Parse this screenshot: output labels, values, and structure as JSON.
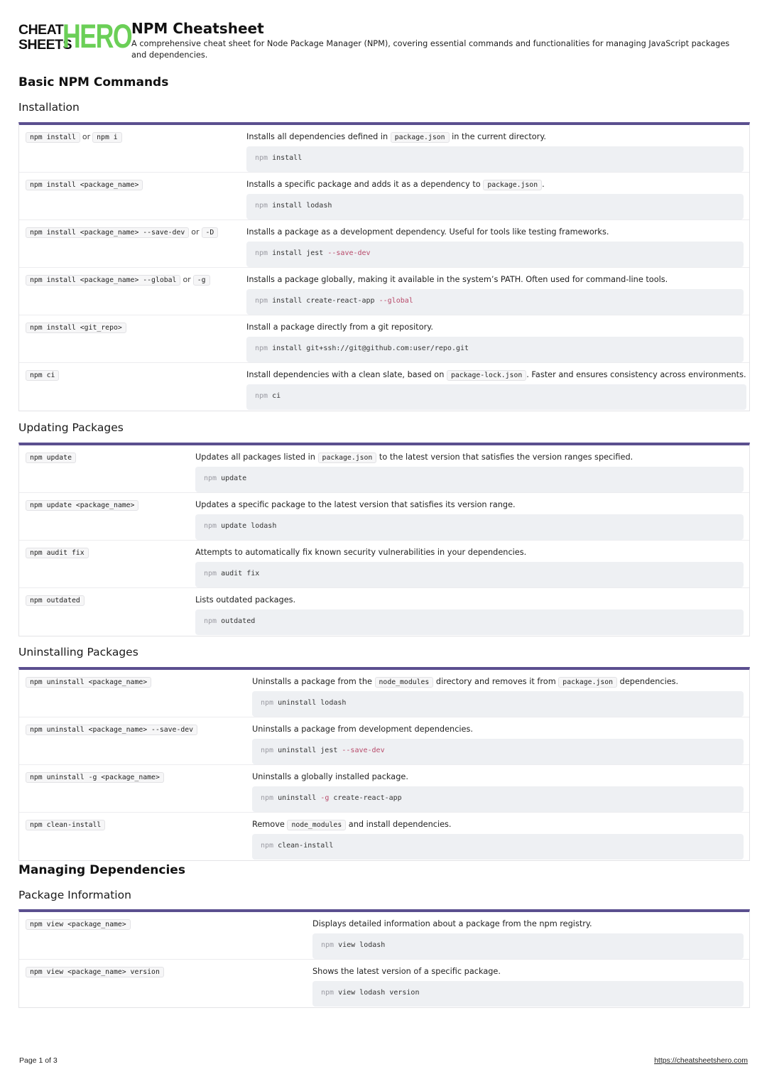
{
  "logo": {
    "line1": "CHEAT",
    "line2": "SHEETS",
    "hero": "HERO"
  },
  "header": {
    "title": "NPM Cheatsheet",
    "subtitle": "A comprehensive cheat sheet for Node Package Manager (NPM), covering essential commands and functionalities for managing JavaScript packages and dependencies."
  },
  "sections": [
    {
      "title": "Basic NPM Commands",
      "subsections": [
        {
          "title": "Installation",
          "rows": [
            {
              "cmd": [
                {
                  "k": "npm install"
                },
                {
                  "t": "or"
                },
                {
                  "k": "npm i"
                }
              ],
              "desc": [
                {
                  "t": "Installs all dependencies defined in "
                },
                {
                  "k": "package.json"
                },
                {
                  "t": " in the current directory."
                }
              ],
              "code": [
                {
                  "n": "npm"
                },
                {
                  "t": " install"
                }
              ]
            },
            {
              "cmd": [
                {
                  "k": "npm install <package_name>"
                }
              ],
              "desc": [
                {
                  "t": "Installs a specific package and adds it as a dependency to "
                },
                {
                  "k": "package.json"
                },
                {
                  "t": "."
                }
              ],
              "code": [
                {
                  "n": "npm"
                },
                {
                  "t": " install lodash"
                }
              ]
            },
            {
              "cmd": [
                {
                  "k": "npm install <package_name> --save-dev"
                },
                {
                  "t": "or"
                },
                {
                  "k": "-D"
                }
              ],
              "desc": [
                {
                  "t": "Installs a package as a development dependency. Useful for tools like testing frameworks."
                }
              ],
              "code": [
                {
                  "n": "npm"
                },
                {
                  "t": " install jest "
                },
                {
                  "f": "--save-dev"
                }
              ]
            },
            {
              "cmd": [
                {
                  "k": "npm install <package_name> --global"
                },
                {
                  "t": "or"
                },
                {
                  "k": "-g"
                }
              ],
              "desc": [
                {
                  "t": "Installs a package globally, making it available in the system’s PATH. Often used for command-line tools."
                }
              ],
              "code": [
                {
                  "n": "npm"
                },
                {
                  "t": " install create-react-app "
                },
                {
                  "f": "--global"
                }
              ]
            },
            {
              "cmd": [
                {
                  "k": "npm install <git_repo>"
                }
              ],
              "desc": [
                {
                  "t": "Install a package directly from a git repository."
                }
              ],
              "code": [
                {
                  "n": "npm"
                },
                {
                  "t": " install git+ssh://git@github.com:user/repo.git"
                }
              ]
            },
            {
              "cmd": [
                {
                  "k": "npm ci"
                }
              ],
              "desc": [
                {
                  "t": "Install dependencies with a clean slate, based on "
                },
                {
                  "k": "package-lock.json"
                },
                {
                  "t": ". Faster and ensures consistency across environments."
                }
              ],
              "code": [
                {
                  "n": "npm"
                },
                {
                  "t": " ci"
                }
              ]
            }
          ]
        },
        {
          "title": "Updating Packages",
          "rows": [
            {
              "cmd": [
                {
                  "k": "npm update"
                }
              ],
              "desc": [
                {
                  "t": "Updates all packages listed in "
                },
                {
                  "k": "package.json"
                },
                {
                  "t": " to the latest version that satisfies the version ranges specified."
                }
              ],
              "code": [
                {
                  "n": "npm"
                },
                {
                  "t": " update"
                }
              ]
            },
            {
              "cmd": [
                {
                  "k": "npm update <package_name>"
                }
              ],
              "desc": [
                {
                  "t": "Updates a specific package to the latest version that satisfies its version range."
                }
              ],
              "code": [
                {
                  "n": "npm"
                },
                {
                  "t": " update lodash"
                }
              ]
            },
            {
              "cmd": [
                {
                  "k": "npm audit fix"
                }
              ],
              "desc": [
                {
                  "t": "Attempts to automatically fix known security vulnerabilities in your dependencies."
                }
              ],
              "code": [
                {
                  "n": "npm"
                },
                {
                  "t": " audit fix"
                }
              ]
            },
            {
              "cmd": [
                {
                  "k": "npm outdated"
                }
              ],
              "desc": [
                {
                  "t": "Lists outdated packages."
                }
              ],
              "code": [
                {
                  "n": "npm"
                },
                {
                  "t": " outdated"
                }
              ]
            }
          ]
        },
        {
          "title": "Uninstalling Packages",
          "rows": [
            {
              "cmd": [
                {
                  "k": "npm uninstall <package_name>"
                }
              ],
              "desc": [
                {
                  "t": "Uninstalls a package from the "
                },
                {
                  "k": "node_modules"
                },
                {
                  "t": " directory and removes it from "
                },
                {
                  "k": "package.json"
                },
                {
                  "t": " dependencies."
                }
              ],
              "code": [
                {
                  "n": "npm"
                },
                {
                  "t": " uninstall lodash"
                }
              ]
            },
            {
              "cmd": [
                {
                  "k": "npm uninstall <package_name> --save-dev"
                }
              ],
              "desc": [
                {
                  "t": "Uninstalls a package from development dependencies."
                }
              ],
              "code": [
                {
                  "n": "npm"
                },
                {
                  "t": " uninstall jest "
                },
                {
                  "f": "--save-dev"
                }
              ]
            },
            {
              "cmd": [
                {
                  "k": "npm uninstall -g <package_name>"
                }
              ],
              "desc": [
                {
                  "t": "Uninstalls a globally installed package."
                }
              ],
              "code": [
                {
                  "n": "npm"
                },
                {
                  "t": " uninstall "
                },
                {
                  "f": "-g"
                },
                {
                  "t": " create-react-app"
                }
              ]
            },
            {
              "cmd": [
                {
                  "k": "npm clean-install"
                }
              ],
              "desc": [
                {
                  "t": "Remove "
                },
                {
                  "k": "node_modules"
                },
                {
                  "t": " and install dependencies."
                }
              ],
              "code": [
                {
                  "n": "npm"
                },
                {
                  "t": " clean-install"
                }
              ]
            }
          ]
        }
      ]
    },
    {
      "title": "Managing Dependencies",
      "subsections": [
        {
          "title": "Package Information",
          "rows": [
            {
              "cmd": [
                {
                  "k": "npm view <package_name>"
                }
              ],
              "desc": [
                {
                  "t": "Displays detailed information about a package from the npm registry."
                }
              ],
              "code": [
                {
                  "n": "npm"
                },
                {
                  "t": " view lodash"
                }
              ]
            },
            {
              "cmd": [
                {
                  "k": "npm view <package_name> version"
                }
              ],
              "desc": [
                {
                  "t": "Shows the latest version of a specific package."
                }
              ],
              "code": [
                {
                  "n": "npm"
                },
                {
                  "t": " view lodash version"
                }
              ]
            }
          ]
        }
      ]
    }
  ],
  "footer": {
    "page": "Page 1 of 3",
    "url": "https://cheatsheetshero.com"
  },
  "colors": {
    "accent_bar": "#5b4f8f",
    "logo_green": "#6bcf57",
    "code_bg": "#eef0f3",
    "flag": "#b84a6a"
  }
}
